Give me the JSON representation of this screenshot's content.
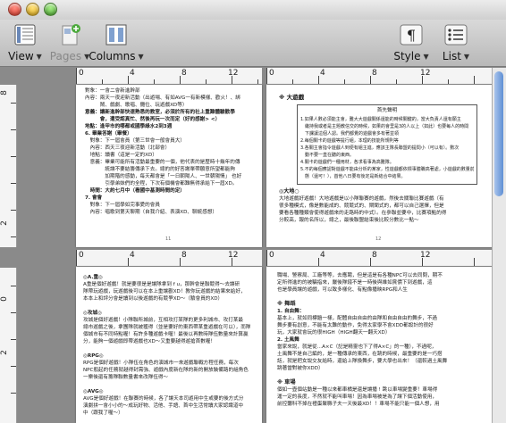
{
  "toolbar": {
    "view_label": "View",
    "pages_label": "Pages",
    "columns_label": "Columns",
    "style_label": "Style",
    "list_label": "List"
  },
  "rulers": {
    "top_left": [
      "0",
      "4",
      "8",
      "12"
    ],
    "top_right": [
      "0",
      "4",
      "8",
      "12"
    ],
    "bottom_left": [
      "0",
      "4",
      "8",
      "12"
    ],
    "bottom_right": [
      "0",
      "4",
      "8",
      "12"
    ]
  },
  "page1": {
    "lines": [
      "對象：一會二會新進幹部",
      "內容：兩天一夜迎新活動（出遊場、有如AVG一有新模樣、歡火！、綁",
      "　　　鬧、戲劇、歌唱、攤位、玩遊戲XD等）",
      "意義：讓新進幹部快速熟悉的教室，必須於所有的社上重難體驗歡學",
      "　　　會，遭受認真忙、然後再玩一次而定（好的感謝> <）",
      "地點：逢甲市的哪都或國學綠水2到3週",
      "6. 畢業答謝（畢餐）",
      "　對象：下一屆會員（第三世會一般會員大）",
      "　內容：西天三夜迎新活動（北部會）",
      "　地點：讀書（這是一定的XD）",
      "　意義：畢業可能所有活動最重要的一個，他代表的是歷時十幾年的傳",
      "　　　　統讓不要結籌傳承下去。總的的好答謝單帶願意所望都能夠",
      "　　　　加期階的感動，每天都會是「一日朝陽人、一世朝陽情」 也好",
      "　　　　引學弟妹們的全程，下次有個機會都難無得承給下一屆XD。",
      "　時間：大約七月中（看國中基測時間的定）",
      "7. 會會",
      "　對象：下一屆學如完事愛的會員",
      "　內容：唱歌到第天聊期（自我介紹、表演XD、聊統感想）"
    ],
    "page_num": "11"
  },
  "page2": {
    "heading": "※ 大遊戲",
    "box_title": "首先聲明",
    "box_lines": [
      "1.如果人數必須能主會，難大大遊戲關係還能的時候關鍵的，當大負責人還有願主",
      "　繼持我或者是主題教信交的時候，如果的會里是3的人以上（如此）也要每人的時間",
      "　下課讓這個人認。我們都覺的遊戲會多有著並領",
      "2.每個關卡的遊戲等提行組，本理的技能所規則等",
      "3.各關主會指令遊戲人到便有組主進，應該主隊長聯盟的提問小（可以有）。數次",
      "　動不要一直在聽的東西。",
      "4.關卡的遊戲們一種用材，各求看事為高難隊。",
      "5.不的每個應認對遊戲不能由分析的某家，性遊戲都依標事體職高著處，小遊戲的數量前狀",
      "　態（還可！），首他八日要有後定是新結合中結果。"
    ],
    "section": "◎大地○",
    "body": [
      "大地遊戲好遊戲！大地遊戲是以小隊聯賽的遊戲，然後去關聯比賽遊戲（有",
      "很多種模式，像是數能成的、競競式的、閘聞式的，都可以自己選擇，但是",
      "要看各種種類會使得遊戲來的走路時的中式）。在參聯並要中，比賽項點的得",
      "分較高，報的名所以，總之，最後聯盟結束後比較分數比一點～"
    ],
    "page_num": "12"
  },
  "page3": {
    "blocks": [
      {
        "head": "◎A.重◎",
        "lines": [
          "A重是個好遊戲！就是要很是是讓隊拿到 f u，那幹會是聯競得～去讓研",
          "隊帶玩遊戲，玩遊戲後可以在本上重讓觀XD！教你玩遊戲的結果來給好，",
          "本本上和評分會是讀到以後遊戲的有競爭XD～（驗會員的XD）"
        ]
      },
      {
        "head": "◎攻城◎",
        "lines": [
          "攻城是個好遊戲！小隊聯所城前，互相攻打某隊的更多利城市、攻打某最",
          "總市遊戲之後，拿團隊就被獲得（並是要好的東西帶某重遊戲在可以），而隊",
          "個城市有不同特點喔！有許多種遊戲卡喔！最後以再數時隊伍數量來計算贏",
          "分，能夠一個遊戲即帶遊戲也XD～又重要越得遊搶首數喔！"
        ]
      },
      {
        "head": "◎RPG◎",
        "lines": [
          "RPG是個好遊戲！小隊伍在角色的演城市一來遊戲聯戰方程任務，每次",
          "NPC般起的任務就越得封需強、遊戲內度新在隊的新的開放裝備路的組角色",
          "一樂後還有籌隊聯數量書來改隊伍得～"
        ]
      },
      {
        "head": "◎AVG◎",
        "lines": [
          "AVG是個好遊戲！在聯賽的時候，各了讓天本司遊用中生或要的後方式分",
          "演劇拼一會小小的～成玩好物、活他、手語、首中生活常讀大家認識道中",
          "中（跟我了喔～）"
        ]
      }
    ]
  },
  "page4": {
    "intro": [
      "職場、警察局、工廠等等，去應聘，但是這是有各種NPC可以去同問，期不",
      "定所得進的的被騙指來，嚴後隊錢不是一時後與維如賞價下到遊戲，這",
      "也是學員讓的遊戲，可以致多樣化、有點像播映RPG和人生"
    ],
    "section1": "※ 舞蹈",
    "sub1": "1. 自由舞：",
    "sub1_lines": [
      "基本上，就如同標題一樣，配體自由自由的由隊和自由自由的舞步，不過",
      "舞步要有創意，不能有太難的動作，免得太家學不會XDD都設計的很好",
      "玩，大家就會玩的很HIGH（HIGH翻天一翻天XD）"
    ],
    "sub2": "2. 土風舞",
    "sub2_lines": [
      "當家來說，就是從...A×C（記是精靈也下了得A×C」的一種），不過呢，",
      "土風舞不是自己編的，是一種傳承的東西，在跳的時候，最重要的是一巧搭",
      "話，就是把女說交友給時，還給上隊換舞步，要大學也出來！（還較過土風舞",
      "跳著當對被你XDD）"
    ],
    "section2": "※ 車場",
    "sub3_lines": [
      "個如一壺個站動是一種以來都車橘是還是讓播 ! 跳以車場變重要！車場得",
      "運一定的長度，不然就不能叫車場！因為車場被是為了讓下個活動使用，",
      "前控聽科不掉在禮蛋聚縣子夫一天後最XD！！車場不能只能一個人想，用"
    ]
  }
}
